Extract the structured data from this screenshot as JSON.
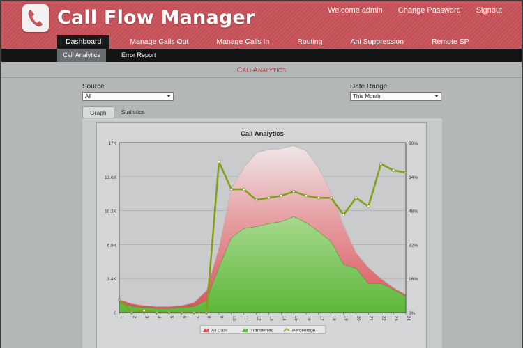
{
  "app": {
    "title": "Call Flow Manager",
    "logo_icon": "phone-icon"
  },
  "top_links": [
    {
      "label": "Welcome admin"
    },
    {
      "label": "Change Password"
    },
    {
      "label": "Signout"
    }
  ],
  "main_nav": [
    {
      "label": "Dashboard",
      "active": true
    },
    {
      "label": "Manage Calls Out"
    },
    {
      "label": "Manage Calls In"
    },
    {
      "label": "Routing"
    },
    {
      "label": "Ani Suppression"
    },
    {
      "label": "Remote SP"
    }
  ],
  "sub_nav": [
    {
      "label": "Call Analytics",
      "active": true
    },
    {
      "label": "Error Report"
    }
  ],
  "page": {
    "title": "CallAnalytics"
  },
  "filters": {
    "source": {
      "label": "Source",
      "value": "All"
    },
    "date_range": {
      "label": "Date Range",
      "value": "This Month"
    }
  },
  "tabs": [
    {
      "label": "Graph",
      "active": true
    },
    {
      "label": "Statistics"
    }
  ],
  "colors": {
    "header": "#c8525a",
    "all_calls": "#d9525a",
    "transferred": "#5db83a",
    "percentage": "#84a018",
    "page_title": "#b8323a"
  },
  "chart_data": {
    "type": "area",
    "title": "Call Analytics",
    "x": [
      "1",
      "2",
      "3",
      "4",
      "5",
      "6",
      "7",
      "8",
      "9",
      "10",
      "11",
      "12",
      "13",
      "14",
      "15",
      "16",
      "17",
      "18",
      "19",
      "20",
      "21",
      "22",
      "23",
      "24"
    ],
    "y_left_ticks": [
      "0",
      "3.4K",
      "6.8K",
      "10.2K",
      "13.6K",
      "17K"
    ],
    "y_right_ticks": [
      "0%",
      "16%",
      "32%",
      "48%",
      "64%",
      "80%"
    ],
    "ylim_left": [
      0,
      17000
    ],
    "ylim_right": [
      0,
      80
    ],
    "series": [
      {
        "name": "All Calls",
        "axis": "left",
        "values": [
          1300,
          900,
          700,
          600,
          600,
          700,
          1000,
          2200,
          6500,
          12500,
          14500,
          16000,
          16300,
          16400,
          16700,
          16200,
          14500,
          12000,
          8700,
          6000,
          4500,
          3400,
          2500,
          1800
        ]
      },
      {
        "name": "Transferred",
        "axis": "left",
        "values": [
          1000,
          600,
          500,
          400,
          400,
          500,
          600,
          1200,
          4500,
          7500,
          8400,
          8600,
          8900,
          9100,
          9600,
          9000,
          8100,
          7100,
          4800,
          4400,
          2900,
          2900,
          2300,
          1600
        ]
      },
      {
        "name": "Percentage",
        "axis": "right",
        "values": [
          6,
          0,
          1,
          0,
          0,
          0,
          0,
          0,
          71,
          58,
          58,
          53,
          54,
          55,
          57,
          55,
          54,
          54,
          46,
          54,
          50,
          70,
          67,
          66
        ]
      }
    ],
    "legend": "bottom",
    "grid": true
  }
}
